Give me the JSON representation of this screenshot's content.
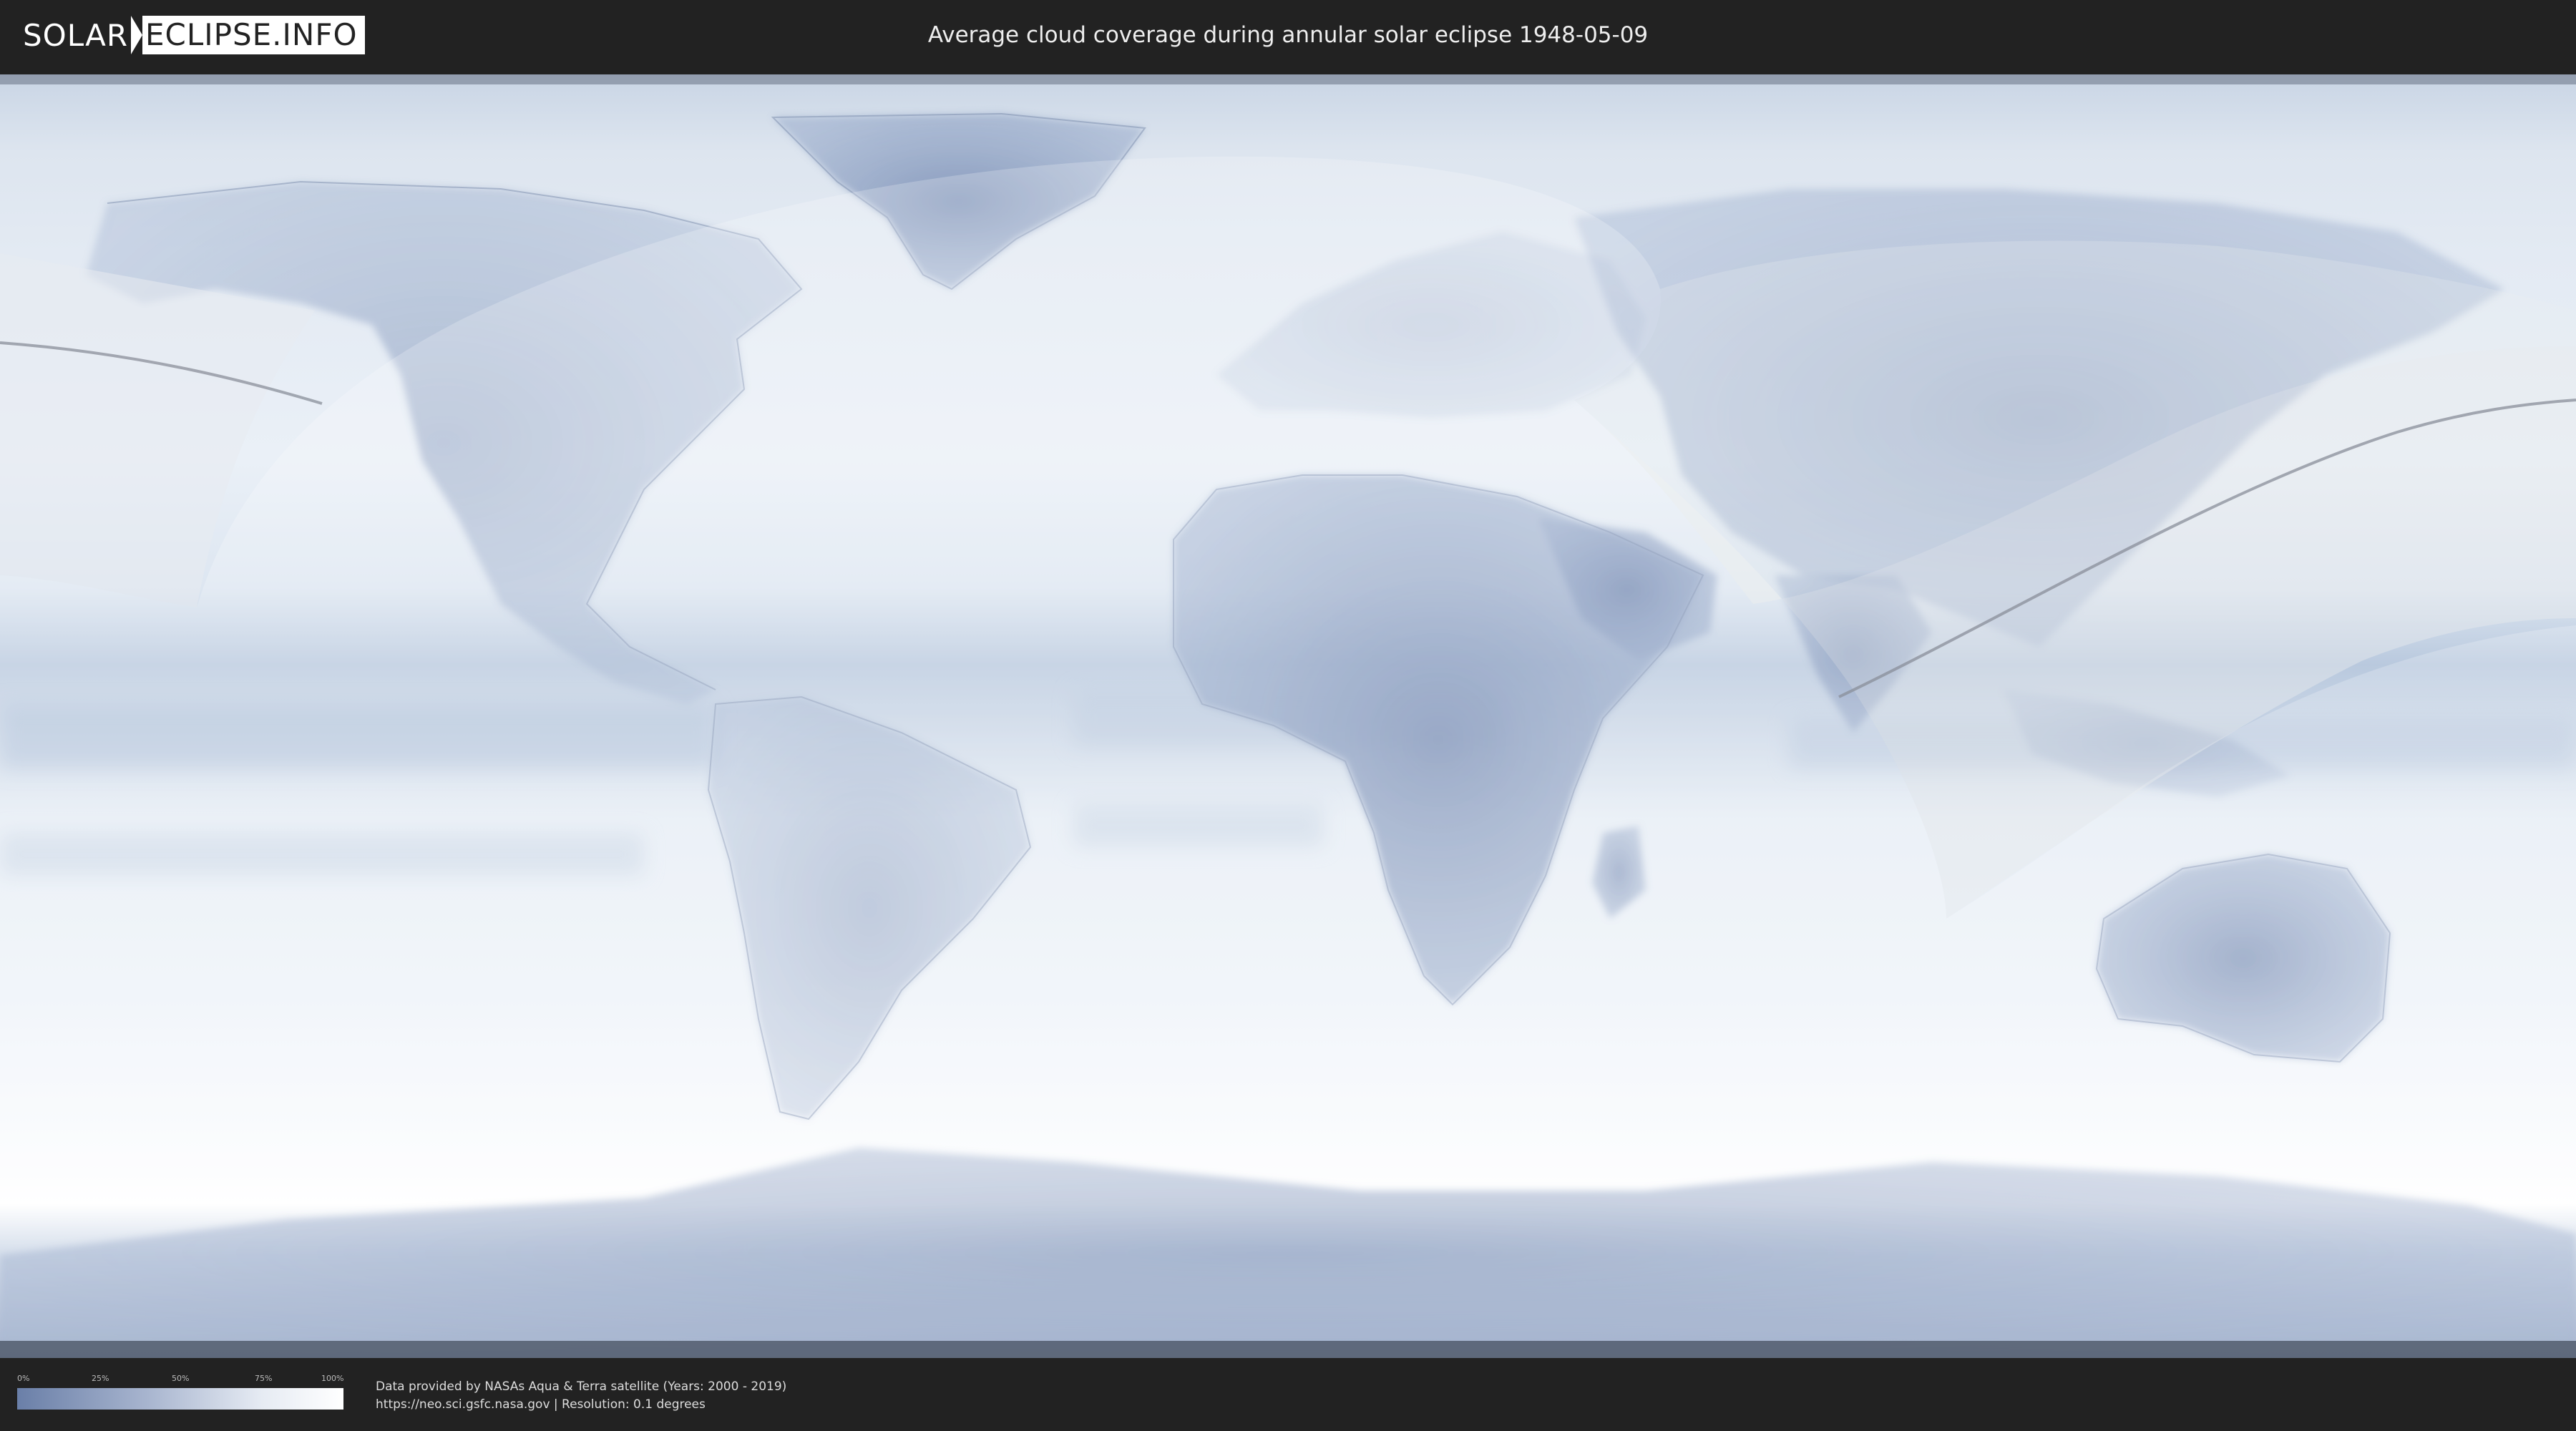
{
  "header": {
    "logo_left": "SOLAR",
    "logo_right": "ECLIPSE.INFO",
    "title": "Average cloud coverage during annular solar eclipse 1948-05-09"
  },
  "map": {
    "colors": {
      "ocean_clear": "#eef3f9",
      "land_dark": "#6d83ad",
      "eclipse_overlay": "#ffffff",
      "path_line": "#8a8f99"
    }
  },
  "legend": {
    "ticks": [
      "0%",
      "25%",
      "50%",
      "75%",
      "100%"
    ],
    "gradient_from": "#6a7fa8",
    "gradient_to": "#ffffff"
  },
  "footer": {
    "line1": "Data provided by NASAs Aqua & Terra satellite (Years: 2000 - 2019)",
    "line2": "https://neo.sci.gsfc.nasa.gov | Resolution: 0.1 degrees"
  }
}
